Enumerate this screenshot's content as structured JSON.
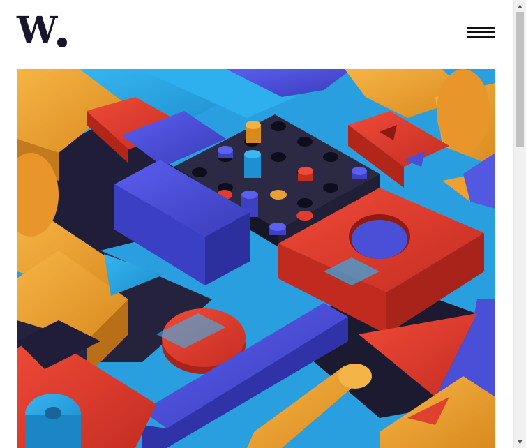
{
  "header": {
    "logo_text": "W",
    "menu_icon": "hamburger-menu-icon"
  },
  "hero": {
    "image_description_icon": "abstract-3d-blocks-image",
    "colors": {
      "background": "#2a9fe0",
      "orange": "#f0a030",
      "red": "#e53b2c",
      "blue": "#4a4fd8",
      "navy": "#1d1b33",
      "cyan": "#2aa8e8"
    }
  },
  "scrollbar": {
    "up_arrow": "▲",
    "down_arrow": "▼"
  }
}
